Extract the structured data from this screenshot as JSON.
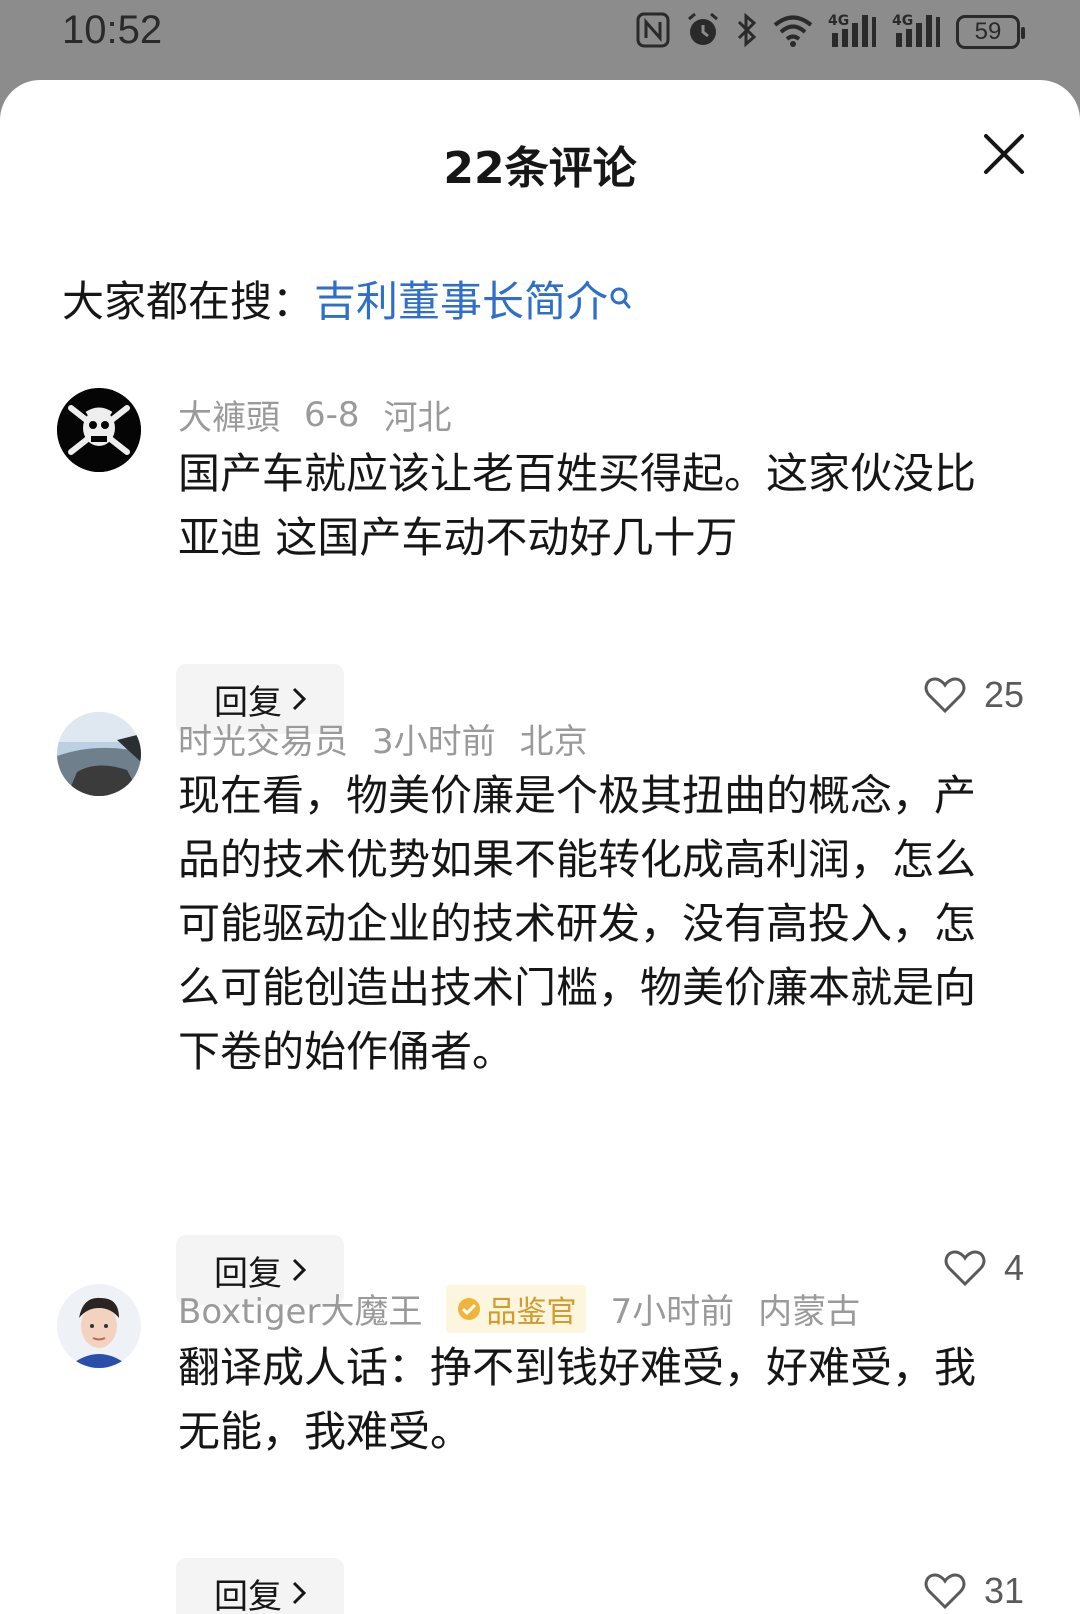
{
  "status_bar": {
    "time": "10:52",
    "battery": "59",
    "icons": [
      "nfc-icon",
      "alarm-icon",
      "bluetooth-icon",
      "wifi-icon",
      "signal-4g-icon",
      "signal-4g-icon",
      "battery-icon"
    ]
  },
  "sheet": {
    "title": "22条评论",
    "close_icon": "close-icon"
  },
  "search": {
    "prefix": "大家都在搜：",
    "link": "吉利董事长简介",
    "icon": "search-icon"
  },
  "comments": [
    {
      "username": "大褲頭",
      "time": "6-8",
      "location": "河北",
      "text": "国产车就应该让老百姓买得起。这家伙没比亚迪 这国产车动不动好几十万",
      "reply_label": "回复",
      "likes": "25"
    },
    {
      "username": "时光交易员",
      "time": "3小时前",
      "location": "北京",
      "text": "现在看，物美价廉是个极其扭曲的概念，产品的技术优势如果不能转化成高利润，怎么可能驱动企业的技术研发，没有高投入，怎么可能创造出技术门槛，物美价廉本就是向下卷的始作俑者。",
      "reply_label": "回复",
      "likes": "4"
    },
    {
      "username": "Boxtiger大魔王",
      "badge": "品鉴官",
      "time": "7小时前",
      "location": "内蒙古",
      "text": "翻译成人话：挣不到钱好难受，好难受，我无能，我难受。",
      "reply_label": "回复",
      "likes": "31"
    }
  ],
  "colors": {
    "link": "#2f6fc9",
    "meta": "#9a9a9a",
    "badge_text": "#d39a2c",
    "badge_bg": "#fdf6df"
  }
}
